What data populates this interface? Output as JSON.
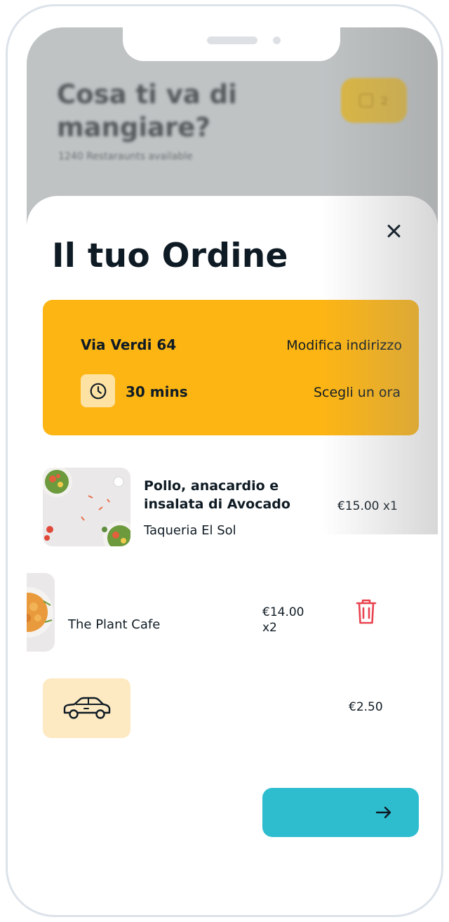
{
  "background": {
    "title": "Cosa ti va di mangiare?",
    "subtitle": "1240 Restaraunts available",
    "cart_count": "2"
  },
  "order": {
    "title": "Il tuo Ordine",
    "address": {
      "street": "Via Verdi 64",
      "edit_label": "Modifica indirizzo",
      "time": "30 mins",
      "time_label": "Scegli un ora"
    },
    "items": [
      {
        "name": "Pollo, anacardio e insalata di Avocado",
        "restaurant": "Taqueria El Sol",
        "price": "€15.00 x1"
      },
      {
        "restaurant": "The Plant Cafe",
        "price": "€14.00 x2"
      }
    ],
    "delivery": {
      "price": "€2.50"
    }
  },
  "colors": {
    "accent": "#fdb514",
    "checkout": "#2ebdcf",
    "delete": "#e8424f",
    "text": "#0f1b24"
  },
  "icons": {
    "close": "close-icon",
    "clock": "clock-icon",
    "trash": "trash-icon",
    "car": "car-icon",
    "arrow": "arrow-right-icon"
  }
}
